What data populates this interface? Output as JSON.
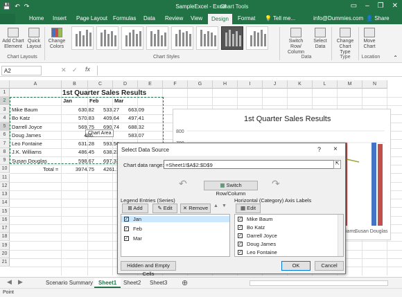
{
  "titlebar": {
    "title": "SampleExcel - Excel",
    "context_tools": "Chart Tools"
  },
  "tabs": [
    "Home",
    "Insert",
    "Page Layout",
    "Formulas",
    "Data",
    "Review",
    "View",
    "Design",
    "Format"
  ],
  "tell_me": "Tell me...",
  "account": "info@Dummies.com",
  "share": "Share",
  "ribbon": {
    "add_chart_element": "Add Chart Element",
    "quick_layout": "Quick Layout",
    "change_colors": "Change Colors",
    "chart_layouts": "Chart Layouts",
    "chart_styles": "Chart Styles",
    "switch_row_column": "Switch Row/ Column",
    "select_data": "Select Data",
    "data_group": "Data",
    "change_chart_type": "Change Chart Type",
    "type_group": "Type",
    "move_chart": "Move Chart",
    "location_group": "Location"
  },
  "namebox": "A2",
  "fx": "fx",
  "columns": [
    "A",
    "B",
    "C",
    "D",
    "E",
    "F",
    "G",
    "H",
    "I",
    "J",
    "K",
    "L",
    "M",
    "N"
  ],
  "rows": [
    "1",
    "2",
    "3",
    "4",
    "5",
    "6",
    "7",
    "8",
    "9",
    "10",
    "11",
    "12",
    "13",
    "14",
    "15",
    "16",
    "17",
    "18",
    "19",
    "20",
    "21"
  ],
  "sheet": {
    "title": "1st Quarter Sales Results",
    "headers": [
      "Jan",
      "Feb",
      "Mar"
    ],
    "data": [
      [
        "Mike Baum",
        "630.82",
        "533.27",
        "663.09"
      ],
      [
        "Bo Katz",
        "570.83",
        "409.64",
        "497.41"
      ],
      [
        "Darrell Joyce",
        "569.75",
        "690.74",
        "688.32"
      ],
      [
        "Doug James",
        "486.",
        "",
        "583.07"
      ],
      [
        "Leo Fontaine",
        "631.28",
        "593.56",
        ""
      ],
      [
        "J.K. Williams",
        "486.45",
        "638.23",
        ""
      ],
      [
        "Susan Douglas",
        "598.67",
        "697.33",
        ""
      ]
    ],
    "total_label": "Total =",
    "totals": [
      "3974.75",
      "4261.1"
    ],
    "tooltip": "Chart Area"
  },
  "chart": {
    "title": "1st Quarter Sales Results",
    "yticks": [
      "800",
      "700"
    ],
    "xlabels": [
      "iams",
      "Susan Douglas"
    ]
  },
  "dialog": {
    "title": "Select Data Source",
    "help": "?",
    "close": "×",
    "range_label": "Chart data range:",
    "range_value": "=Sheet1!$A$2:$D$9",
    "switch": "Switch Row/Column",
    "legend_label": "Legend Entries (Series)",
    "add": "Add",
    "edit": "Edit",
    "remove": "Remove",
    "series": [
      "Jan",
      "Feb",
      "Mar"
    ],
    "axis_label": "Horizontal (Category) Axis Labels",
    "axis_edit": "Edit",
    "categories": [
      "Mike Baum",
      "Bo Katz",
      "Darrell Joyce",
      "Doug James",
      "Leo Fontaine"
    ],
    "hidden": "Hidden and Empty Cells",
    "ok": "OK",
    "cancel": "Cancel"
  },
  "sheettabs": [
    "Scenario Summary",
    "Sheet1",
    "Sheet2",
    "Sheet3"
  ],
  "status": "Point",
  "colors": {
    "excel_green": "#217346",
    "bar_blue": "#4472c4",
    "bar_red": "#c0504d",
    "series_line": "#a0a030"
  }
}
